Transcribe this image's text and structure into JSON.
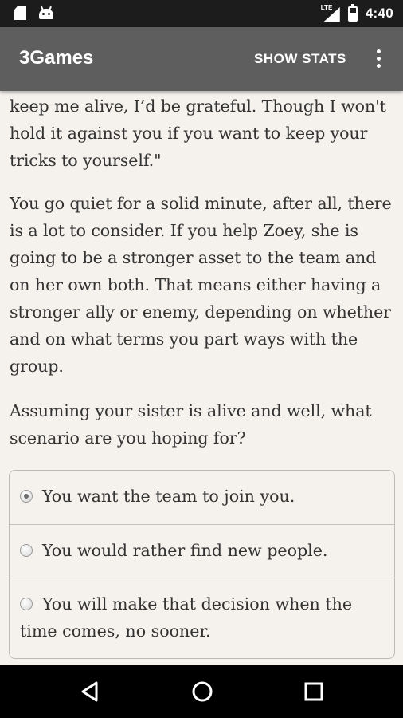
{
  "status_bar": {
    "time": "4:40",
    "network_label": "LTE",
    "icons": [
      "sd-card-icon",
      "android-debug-icon",
      "signal-lte-icon",
      "battery-charging-icon"
    ]
  },
  "app_bar": {
    "title": "3Games",
    "show_stats_label": "SHOW STATS",
    "overflow_icon": "more-vert-icon"
  },
  "story": {
    "paragraphs": [
      "keep me alive, I’d be grateful. Though I won't hold it against you if you want to keep your tricks to yourself.\"",
      "You go quiet for a solid minute, after all, there is a lot to consider. If you help Zoey, she is going to be a stronger asset to the team and on her own both. That means either having a stronger ally or enemy, depending on whether and on what terms you part ways with the group.",
      "Assuming your sister is alive and well, what scenario are you hoping for?"
    ]
  },
  "choices": [
    {
      "label": "You want the team to join you.",
      "selected": true
    },
    {
      "label": "You would rather find new people.",
      "selected": false
    },
    {
      "label": "You will make that decision when the time comes, no sooner.",
      "selected": false
    }
  ],
  "nav_bar": {
    "icons": [
      "back-icon",
      "home-icon",
      "recent-apps-icon"
    ]
  },
  "colors": {
    "app_bar": "#5e5e5e",
    "status_bar": "#1c1c1c",
    "background": "#f5f2ed",
    "text": "#333333"
  }
}
